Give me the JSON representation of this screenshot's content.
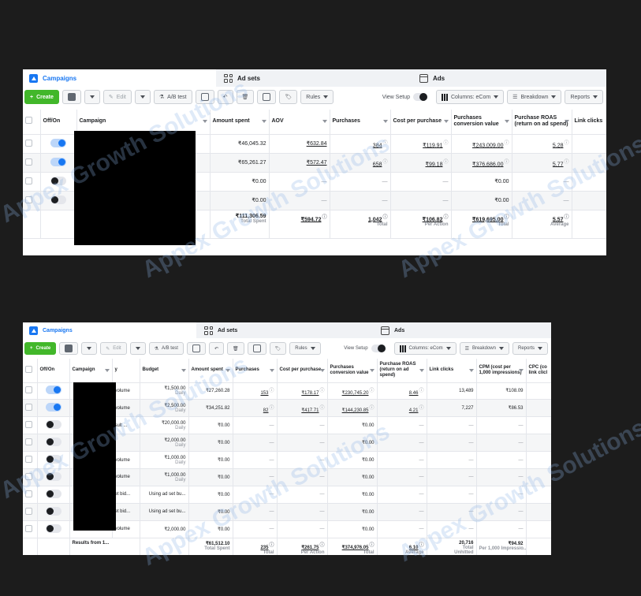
{
  "toolbar_labels": {
    "create": "Create",
    "edit": "Edit",
    "ab_test": "A/B test",
    "rules": "Rules",
    "view_setup": "View Setup",
    "columns": "Columns: eCom",
    "breakdown": "Breakdown",
    "reports": "Reports"
  },
  "tabs": {
    "campaigns": "Campaigns",
    "ad_sets": "Ad sets",
    "ads": "Ads"
  },
  "watermark_text": "Appex Growth Solutions",
  "panel1": {
    "headers": {
      "off_on": "Off/On",
      "campaign": "Campaign",
      "amount_spent": "Amount spent",
      "aov": "AOV",
      "purchases": "Purchases",
      "cost_per_purchase": "Cost per purchase",
      "pcv": "Purchases conversion value",
      "roas": "Purchase ROAS (return on ad spend)",
      "link_clicks": "Link clicks"
    },
    "rows": [
      {
        "amount": "₹46,045.32",
        "aov": "₹632.84",
        "purchases": "384",
        "cpp": "₹119.91",
        "pcv": "₹243,009.00",
        "roas": "5.28"
      },
      {
        "amount": "₹65,261.27",
        "aov": "₹572.47",
        "purchases": "658",
        "cpp": "₹99.18",
        "pcv": "₹376,686.00",
        "roas": "5.77"
      },
      {
        "amount": "₹0.00",
        "aov": "—",
        "purchases": "—",
        "cpp": "—",
        "pcv": "₹0.00",
        "roas": "—"
      },
      {
        "amount": "₹0.00",
        "aov": "—",
        "purchases": "—",
        "cpp": "—",
        "pcv": "₹0.00",
        "roas": "—"
      }
    ],
    "totals": {
      "amount": "₹111,306.59",
      "amount_note": "Total Spent",
      "aov": "₹594.72",
      "purchases": "1,042",
      "purchases_note": "Total",
      "cpp": "₹106.82",
      "cpp_note": "Per Action",
      "pcv": "₹619,695.00",
      "pcv_note": "Total",
      "roas": "5.57",
      "roas_note": "Average"
    }
  },
  "panel2": {
    "headers": {
      "off_on": "Off/On",
      "campaign": "Campaign",
      "strategy_frag": "y",
      "budget": "Budget",
      "amount_spent": "Amount spent",
      "purchases": "Purchases",
      "cost_per_purchase": "Cost per purchase",
      "pcv": "Purchases conversion value",
      "roas": "Purchase ROAS (return on ad spend)",
      "link_clicks": "Link clicks",
      "cpm": "CPM (cost per 1,000 impressions)",
      "cpc": "CPC (co link clicl"
    },
    "rows": [
      {
        "strategy": "volume",
        "budget": "₹1,500.00",
        "budget_note": "Daily",
        "amount": "₹27,260.28",
        "purchases": "153",
        "cpp": "₹178.17",
        "pcv": "₹230,745.20",
        "roas": "8.46",
        "clicks": "13,489",
        "cpm": "₹108.09"
      },
      {
        "strategy": "volume",
        "budget": "₹2,500.00",
        "budget_note": "Daily",
        "amount": "₹34,251.82",
        "purchases": "82",
        "cpp": "₹417.71",
        "pcv": "₹144,230.85",
        "roas": "4.21",
        "clicks": "7,227",
        "cpm": "₹86.53"
      },
      {
        "strategy": "sult ...",
        "budget": "₹20,000.00",
        "budget_note": "Daily",
        "amount": "₹0.00",
        "purchases": "—",
        "cpp": "—",
        "pcv": "₹0.00",
        "roas": "—",
        "clicks": "—",
        "cpm": "—"
      },
      {
        "strategy": "",
        "budget": "₹2,000.00",
        "budget_note": "Daily",
        "amount": "₹0.00",
        "purchases": "—",
        "cpp": "—",
        "pcv": "₹0.00",
        "roas": "—",
        "clicks": "—",
        "cpm": "—"
      },
      {
        "strategy": "volume",
        "budget": "₹1,000.00",
        "budget_note": "Daily",
        "amount": "₹0.00",
        "purchases": "—",
        "cpp": "—",
        "pcv": "₹0.00",
        "roas": "—",
        "clicks": "—",
        "cpm": "—"
      },
      {
        "strategy": "volume",
        "budget": "₹1,000.00",
        "budget_note": "Daily",
        "amount": "₹0.00",
        "purchases": "—",
        "cpp": "—",
        "pcv": "₹0.00",
        "roas": "—",
        "clicks": "—",
        "cpm": "—"
      },
      {
        "strategy": "et bid...",
        "budget": "Using ad set bu...",
        "budget_note": "",
        "amount": "₹0.00",
        "purchases": "—",
        "cpp": "—",
        "pcv": "₹0.00",
        "roas": "—",
        "clicks": "—",
        "cpm": "—"
      },
      {
        "strategy": "et bid...",
        "budget": "Using ad set bu...",
        "budget_note": "",
        "amount": "₹0.00",
        "purchases": "—",
        "cpp": "—",
        "pcv": "₹0.00",
        "roas": "—",
        "clicks": "—",
        "cpm": "—"
      },
      {
        "strategy": "volume",
        "budget": "₹2,000.00",
        "budget_note": "",
        "amount": "₹0.00",
        "purchases": "—",
        "cpp": "—",
        "pcv": "₹0.00",
        "roas": "—",
        "clicks": "—",
        "cpm": "—"
      }
    ],
    "totals": {
      "label": "Results from 1...",
      "amount": "₹61,512.10",
      "amount_note": "Total Spent",
      "purchases": "235",
      "purchases_note": "Total",
      "cpp": "₹261.75",
      "cpp_note": "Per Action",
      "pcv": "₹374,976.05",
      "pcv_note": "Total",
      "roas": "6.10",
      "roas_note": "Average",
      "clicks": "20,716",
      "clicks_note": "Total",
      "cpm": "₹94.92",
      "cpm_note": "Per 1,000 Impressio...",
      "extra_note": "Unhitted"
    }
  }
}
